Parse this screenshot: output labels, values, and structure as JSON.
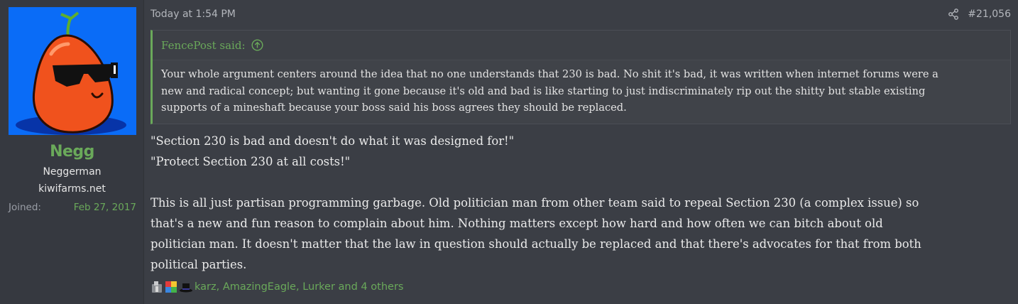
{
  "user": {
    "name": "Negg",
    "title": "Neggerman",
    "banner": "kiwifarms.net",
    "joined_label": "Joined:",
    "joined_value": "Feb 27, 2017"
  },
  "post": {
    "date": "Today at 1:54 PM",
    "number": "#21,056"
  },
  "quote": {
    "author_line": "FencePost said:",
    "lines": [
      "Your whole argument centers around the idea that no one understands that 230 is bad. No shit it's bad, it was written when internet forums were a",
      "new and radical concept; but wanting it gone because it's old and bad is like starting to just indiscriminately rip out the shitty but stable existing",
      "supports of a mineshaft because your boss said his boss agrees they should be replaced."
    ]
  },
  "body": {
    "line1": "\"Section 230 is bad and doesn't do what it was designed for!\"",
    "line2": "\"Protect Section 230 at all costs!\"",
    "para_lines": [
      "This is all just partisan programming garbage. Old politician man from other team said to repeal Section 230 (a complex issue) so",
      "that's a new and fun reason to complain about him. Nothing matters except how hard and how often we can bitch about old",
      "politician man. It doesn't matter that the law in question should actually be replaced and that there's advocates for that from both",
      "political parties."
    ]
  },
  "reactions": {
    "icons": [
      "cross-meme-icon",
      "autism-puzzle-icon",
      "top-hat-icon"
    ],
    "text": "karz, AmazingEagle, Lurker and 4 others"
  },
  "colors": {
    "accent_green": "#6aa95a",
    "background": "#3b3e45",
    "sidebar": "#363940",
    "avatar_bg": "#0a6cf7",
    "egg_orange": "#f0521d"
  }
}
